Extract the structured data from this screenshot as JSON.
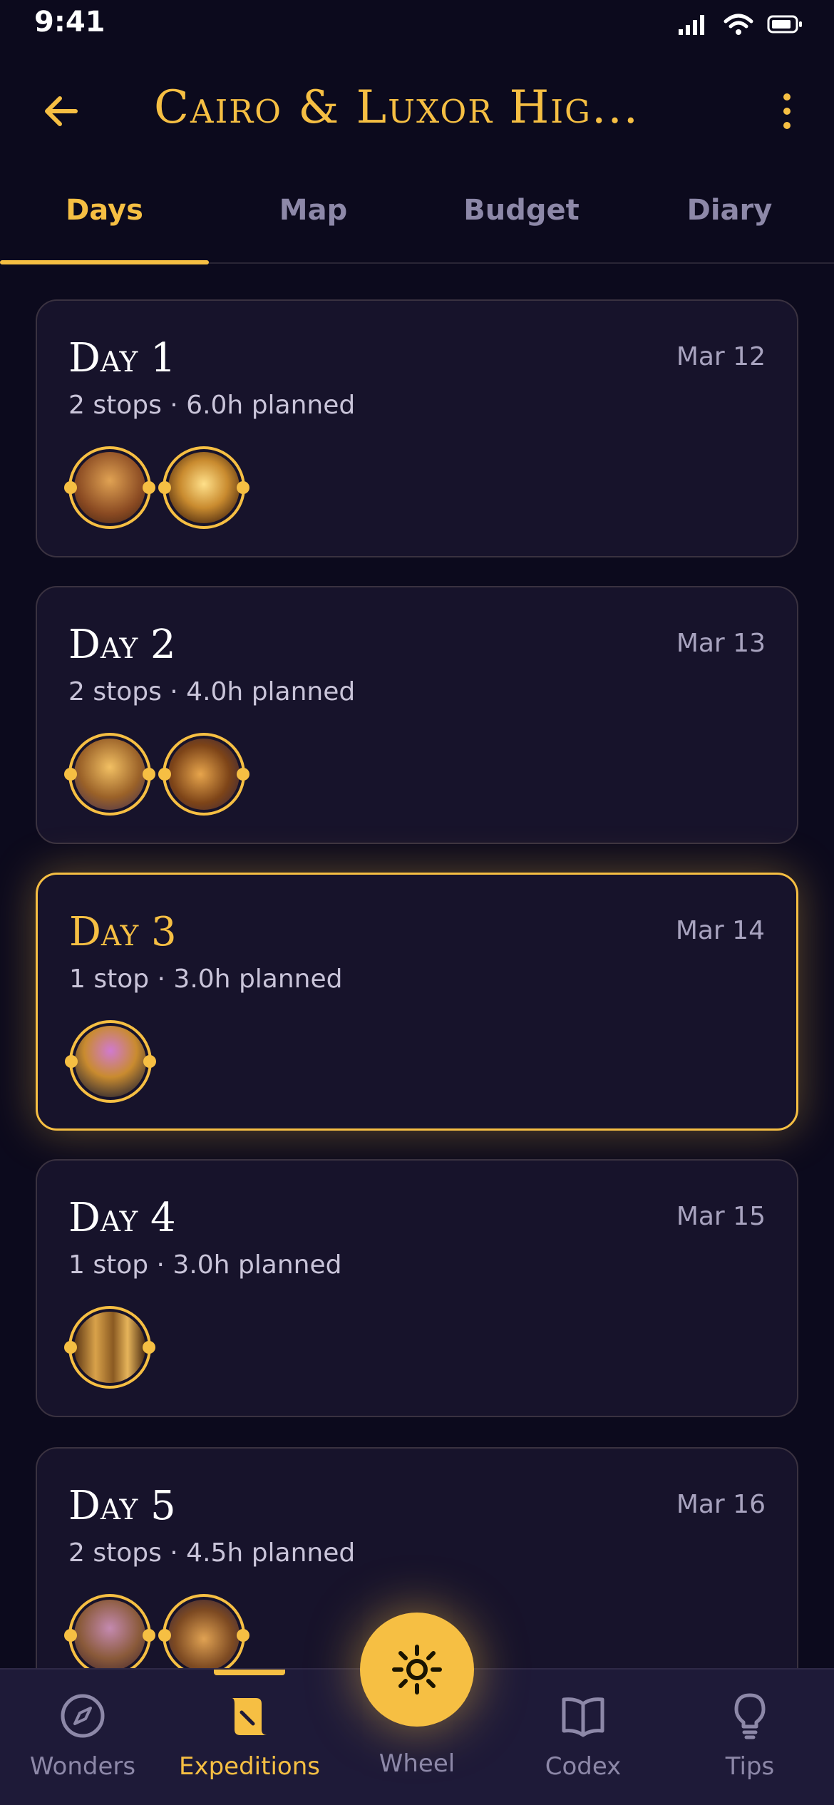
{
  "status_bar": {
    "time": "9:41"
  },
  "header": {
    "title": "Cairo & Luxor Hig..."
  },
  "tabs": [
    {
      "label": "Days",
      "active": true
    },
    {
      "label": "Map",
      "active": false
    },
    {
      "label": "Budget",
      "active": false
    },
    {
      "label": "Diary",
      "active": false
    }
  ],
  "days": [
    {
      "title": "Day 1",
      "date": "Mar 12",
      "meta": "2 stops · 6.0h planned",
      "stops": 2,
      "selected": false
    },
    {
      "title": "Day 2",
      "date": "Mar 13",
      "meta": "2 stops · 4.0h planned",
      "stops": 2,
      "selected": false
    },
    {
      "title": "Day 3",
      "date": "Mar 14",
      "meta": "1 stop · 3.0h planned",
      "stops": 1,
      "selected": true
    },
    {
      "title": "Day 4",
      "date": "Mar 15",
      "meta": "1 stop · 3.0h planned",
      "stops": 1,
      "selected": false
    },
    {
      "title": "Day 5",
      "date": "Mar 16",
      "meta": "2 stops · 4.5h planned",
      "stops": 2,
      "selected": false
    }
  ],
  "bottom_nav": [
    {
      "label": "Wonders",
      "icon": "compass-icon",
      "active": false
    },
    {
      "label": "Expeditions",
      "icon": "scroll-icon",
      "active": true
    },
    {
      "label": "Wheel",
      "icon": "sun-icon",
      "active": false
    },
    {
      "label": "Codex",
      "icon": "book-icon",
      "active": false
    },
    {
      "label": "Tips",
      "icon": "lightbulb-icon",
      "active": false
    }
  ],
  "colors": {
    "accent": "#f6bf43",
    "background": "#0c0a1d",
    "card": "#17132b",
    "muted": "#8d88a8"
  }
}
